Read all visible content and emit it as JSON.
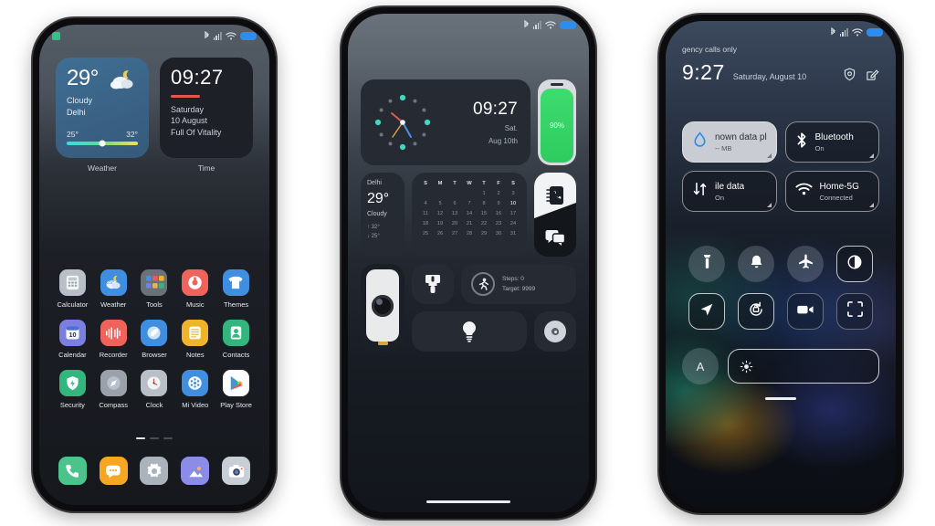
{
  "statusbar": {
    "icons": [
      "bluetooth-icon",
      "signal-icon",
      "wifi-icon",
      "battery-icon"
    ],
    "badge": "notification-badge"
  },
  "phone1": {
    "weather_widget": {
      "temp": "29°",
      "condition": "Cloudy",
      "city": "Delhi",
      "low": "25°",
      "high": "32°",
      "caption": "Weather",
      "icon": "cloud-moon-icon"
    },
    "time_widget": {
      "time": "09:27",
      "weekday": "Saturday",
      "date": "10 August",
      "motto": "Full Of Vitality",
      "caption": "Time",
      "accent": "#e8544f"
    },
    "apps": [
      {
        "label": "Calculator",
        "icon": "calculator-icon",
        "color": "#b9bfc6"
      },
      {
        "label": "Weather",
        "icon": "weather-icon",
        "color": "#3f8ee0"
      },
      {
        "label": "Tools",
        "icon": "folder-icon",
        "color": "#6b7179"
      },
      {
        "label": "Music",
        "icon": "music-icon",
        "color": "#f0635b"
      },
      {
        "label": "Themes",
        "icon": "themes-icon",
        "color": "#3f8ee0"
      },
      {
        "label": "Calendar",
        "icon": "calendar-icon",
        "color": "#7b7fe0"
      },
      {
        "label": "Recorder",
        "icon": "recorder-icon",
        "color": "#f0635b"
      },
      {
        "label": "Browser",
        "icon": "browser-icon",
        "color": "#3f8ee0"
      },
      {
        "label": "Notes",
        "icon": "notes-icon",
        "color": "#f0b429"
      },
      {
        "label": "Contacts",
        "icon": "contacts-icon",
        "color": "#35b57e"
      },
      {
        "label": "Security",
        "icon": "shield-icon",
        "color": "#35b57e"
      },
      {
        "label": "Compass",
        "icon": "compass-icon",
        "color": "#9aa1aa"
      },
      {
        "label": "Clock",
        "icon": "clock-icon",
        "color": "#b9bfc6"
      },
      {
        "label": "Mi Video",
        "icon": "video-icon",
        "color": "#3f8ee0"
      },
      {
        "label": "Play Store",
        "icon": "play-store-icon",
        "color": "#ffffff"
      }
    ],
    "page_dots": 3,
    "active_dot": 0,
    "dock": [
      {
        "name": "phone-app",
        "icon": "phone-icon",
        "color": "#4cc38a"
      },
      {
        "name": "messages-app",
        "icon": "message-icon",
        "color": "#f5a623"
      },
      {
        "name": "settings-app",
        "icon": "gear-icon",
        "color": "#aab2bc"
      },
      {
        "name": "gallery-app",
        "icon": "gallery-icon",
        "color": "#8b8ce8"
      },
      {
        "name": "camera-app",
        "icon": "camera-icon",
        "color": "#c8ced6"
      }
    ]
  },
  "phone2": {
    "clock_tile": {
      "time": "09:27",
      "weekday": "Sat.",
      "date": "Aug 10th"
    },
    "battery_tile": {
      "percent": "90%",
      "color": "#2fcb60"
    },
    "weather_tile": {
      "city": "Delhi",
      "temp": "29°",
      "condition": "Cloudy",
      "high": "32°",
      "low": "25°"
    },
    "calendar_tile": {
      "headers": [
        "S",
        "M",
        "T",
        "W",
        "T",
        "F",
        "S"
      ],
      "blanks": 4,
      "days": [
        1,
        2,
        3,
        4,
        5,
        6,
        7,
        8,
        9,
        10,
        11,
        12,
        13,
        14,
        15,
        16,
        17,
        18,
        19,
        20,
        21,
        22,
        23,
        24,
        25,
        26,
        27,
        28,
        29,
        30,
        31
      ],
      "today": 10
    },
    "comm_tile": {
      "top_icon": "contacts-book-icon",
      "bottom_icon": "chat-icon"
    },
    "camera_tile": {
      "icon": "camera-icon"
    },
    "brush_tile": {
      "icon": "paint-brush-icon"
    },
    "fitness_tile": {
      "steps_label": "Steps:  0",
      "target_label": "Target:  9999",
      "icon": "running-icon"
    },
    "bulb_tile": {
      "icon": "lightbulb-icon"
    },
    "knob_tile": {
      "icon": "dial-knob-icon"
    }
  },
  "phone3": {
    "carrier": "gency calls only",
    "time": "9:27",
    "date": "Saturday, August 10",
    "actions": [
      {
        "name": "settings-gear-icon"
      },
      {
        "name": "edit-icon"
      }
    ],
    "tiles": [
      {
        "title": "nown data pla",
        "subtitle": "-- MB",
        "icon": "data-drop-icon",
        "state": "on-light"
      },
      {
        "title": "Bluetooth",
        "subtitle": "On",
        "icon": "bluetooth-icon",
        "state": "on"
      },
      {
        "title": "ile data",
        "subtitle": "On",
        "icon": "mobile-data-icon",
        "state": "on"
      },
      {
        "title": "Home-5G",
        "subtitle": "Connected",
        "icon": "wifi-icon",
        "state": "on"
      }
    ],
    "toggles": [
      {
        "name": "flashlight-icon",
        "shape": "circle"
      },
      {
        "name": "bell-icon",
        "shape": "circle"
      },
      {
        "name": "airplane-icon",
        "shape": "circle"
      },
      {
        "name": "dark-mode-icon",
        "shape": "square"
      },
      {
        "name": "location-icon",
        "shape": "square"
      },
      {
        "name": "auto-rotate-icon",
        "shape": "square"
      },
      {
        "name": "screen-record-icon",
        "shape": "square-dim"
      },
      {
        "name": "scanner-icon",
        "shape": "square-dim"
      }
    ],
    "auto_brightness": "A",
    "brightness_icon": "sun-icon"
  }
}
